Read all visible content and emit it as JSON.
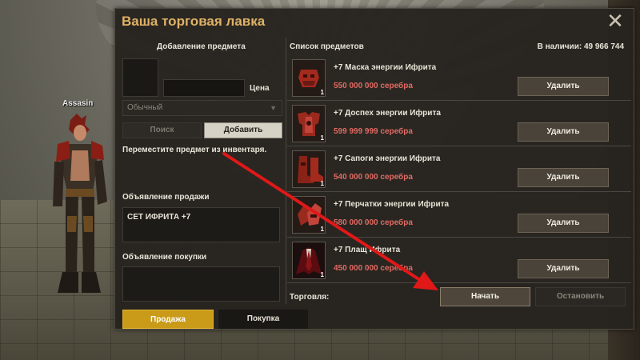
{
  "character": {
    "name": "Assasin"
  },
  "window": {
    "title": "Ваша торговая лавка",
    "close_icon": "close-icon",
    "close_glyph": "✕"
  },
  "add_item": {
    "section_title": "Добавление предмета",
    "price_label": "Цена",
    "grade_select_value": "Обычный",
    "search_label": "Поиск",
    "add_label": "Добавить",
    "hint": "Переместите предмет из инвентаря."
  },
  "announcements": {
    "sell_title": "Объявление продажи",
    "sell_text": "СЕТ ИФРИТА +7",
    "buy_title": "Объявление покупки",
    "buy_text": ""
  },
  "tabs": [
    {
      "label": "Продажа",
      "active": true
    },
    {
      "label": "Покупка",
      "active": false
    }
  ],
  "item_list": {
    "header": "Список предметов",
    "balance": "В наличии: 49 966 744",
    "delete_label": "Удалить",
    "items": [
      {
        "name": "+7 Маска энергии Ифрита",
        "price": "550 000 000 серебра",
        "qty": "1",
        "icon": "mask-icon"
      },
      {
        "name": "+7 Доспех энергии Ифрита",
        "price": "599 999 999 серебра",
        "qty": "1",
        "icon": "armor-icon"
      },
      {
        "name": "+7 Сапоги энергии Ифрита",
        "price": "540 000 000 серебра",
        "qty": "1",
        "icon": "boots-icon"
      },
      {
        "name": "+7 Перчатки энергии Ифрита",
        "price": "580 000 000 серебра",
        "qty": "1",
        "icon": "gloves-icon"
      },
      {
        "name": "+7 Плащ Ифрита",
        "price": "450 000 000 серебра",
        "qty": "1",
        "icon": "cloak-icon"
      }
    ]
  },
  "trade": {
    "label": "Торговля:",
    "start_label": "Начать",
    "stop_label": "Остановить"
  },
  "colors": {
    "title": "#e0b266",
    "price": "#e06a62",
    "active_tab": "#c99b19",
    "annotation_arrow": "#e01818"
  }
}
